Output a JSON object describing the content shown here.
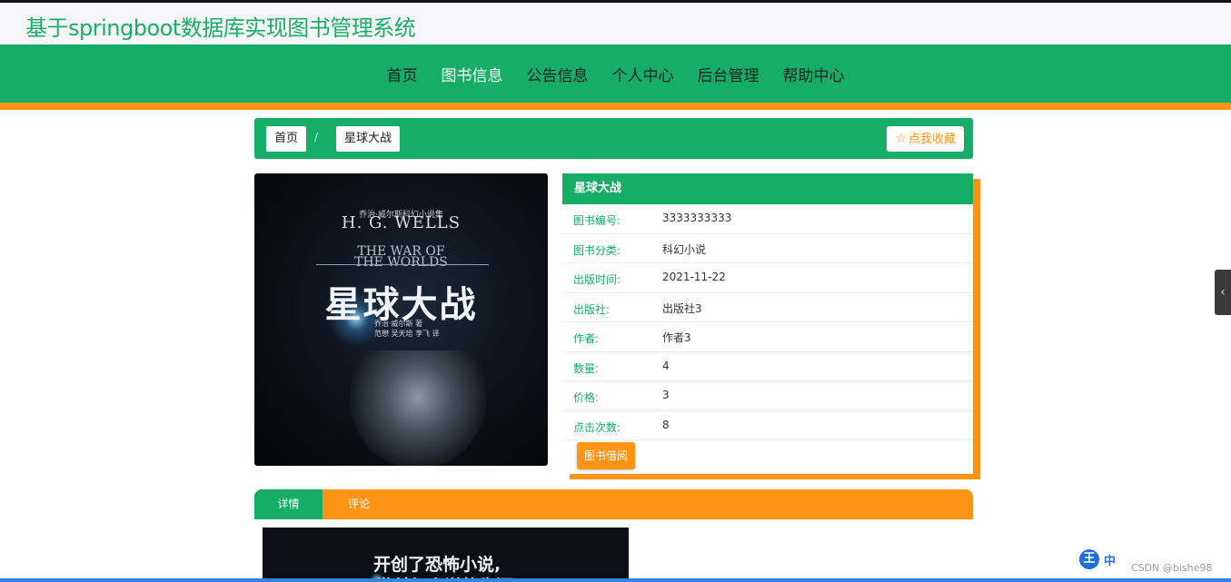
{
  "site": {
    "title": "基于springboot数据库实现图书管理系统"
  },
  "nav": {
    "items": [
      {
        "label": "首页"
      },
      {
        "label": "图书信息"
      },
      {
        "label": "公告信息"
      },
      {
        "label": "个人中心"
      },
      {
        "label": "后台管理"
      },
      {
        "label": "帮助中心"
      }
    ],
    "active_index": 1
  },
  "breadcrumb": {
    "home": "首页",
    "separator": "/",
    "current": "星球大战"
  },
  "favorite_button": {
    "icon": "star-outline-icon",
    "label": "点我收藏"
  },
  "cover": {
    "series": "乔治·威尔斯科幻小说集",
    "author_en": "H. G. WELLS",
    "title_en_1": "THE WAR OF",
    "title_en_2": "THE WORLDS",
    "title_cn": "星球大战",
    "author_cn": "乔治·威尔斯 著",
    "translators": "范懋 吴天培 李飞 译"
  },
  "book": {
    "name": "星球大战",
    "fields": [
      {
        "key": "图书编号:",
        "value": "3333333333"
      },
      {
        "key": "图书分类:",
        "value": "科幻小说"
      },
      {
        "key": "出版时间:",
        "value": "2021-11-22"
      },
      {
        "key": "出版社:",
        "value": "出版社3"
      },
      {
        "key": "作者:",
        "value": "作者3"
      },
      {
        "key": "数量:",
        "value": "4"
      },
      {
        "key": "价格:",
        "value": "3"
      },
      {
        "key": "点击次数:",
        "value": "8"
      }
    ],
    "borrow_label": "图书借阅"
  },
  "tabs": [
    {
      "label": "详情"
    },
    {
      "label": "评论"
    }
  ],
  "detail_image": {
    "line1": "开创了恐怖小说,",
    "line2": "世科幻小说的先河"
  },
  "ime_toolbar": {
    "logo": "王",
    "mode": "中"
  },
  "watermark": "CSDN @bishe98",
  "colors": {
    "green": "#16ae67",
    "orange": "#fe9416",
    "title_green": "#19ae68"
  }
}
